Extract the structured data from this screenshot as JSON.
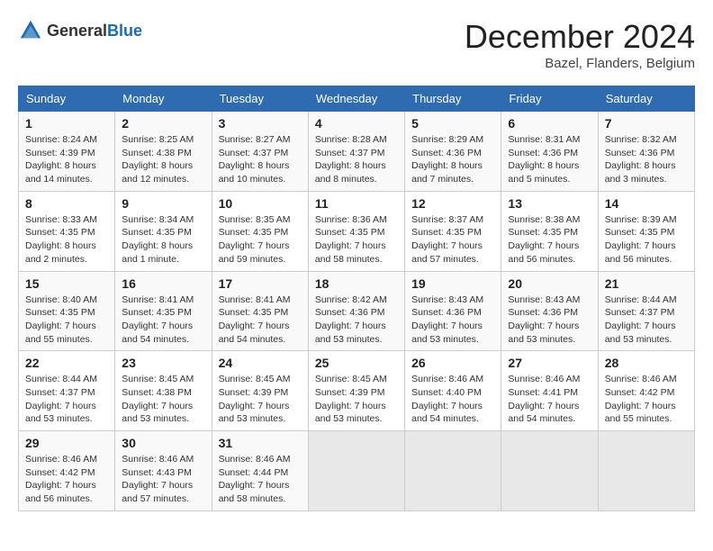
{
  "header": {
    "logo_general": "General",
    "logo_blue": "Blue",
    "month_title": "December 2024",
    "location": "Bazel, Flanders, Belgium"
  },
  "days_of_week": [
    "Sunday",
    "Monday",
    "Tuesday",
    "Wednesday",
    "Thursday",
    "Friday",
    "Saturday"
  ],
  "weeks": [
    [
      {
        "day": "1",
        "sunrise": "8:24 AM",
        "sunset": "4:39 PM",
        "daylight": "8 hours and 14 minutes."
      },
      {
        "day": "2",
        "sunrise": "8:25 AM",
        "sunset": "4:38 PM",
        "daylight": "8 hours and 12 minutes."
      },
      {
        "day": "3",
        "sunrise": "8:27 AM",
        "sunset": "4:37 PM",
        "daylight": "8 hours and 10 minutes."
      },
      {
        "day": "4",
        "sunrise": "8:28 AM",
        "sunset": "4:37 PM",
        "daylight": "8 hours and 8 minutes."
      },
      {
        "day": "5",
        "sunrise": "8:29 AM",
        "sunset": "4:36 PM",
        "daylight": "8 hours and 7 minutes."
      },
      {
        "day": "6",
        "sunrise": "8:31 AM",
        "sunset": "4:36 PM",
        "daylight": "8 hours and 5 minutes."
      },
      {
        "day": "7",
        "sunrise": "8:32 AM",
        "sunset": "4:36 PM",
        "daylight": "8 hours and 3 minutes."
      }
    ],
    [
      {
        "day": "8",
        "sunrise": "8:33 AM",
        "sunset": "4:35 PM",
        "daylight": "8 hours and 2 minutes."
      },
      {
        "day": "9",
        "sunrise": "8:34 AM",
        "sunset": "4:35 PM",
        "daylight": "8 hours and 1 minute."
      },
      {
        "day": "10",
        "sunrise": "8:35 AM",
        "sunset": "4:35 PM",
        "daylight": "7 hours and 59 minutes."
      },
      {
        "day": "11",
        "sunrise": "8:36 AM",
        "sunset": "4:35 PM",
        "daylight": "7 hours and 58 minutes."
      },
      {
        "day": "12",
        "sunrise": "8:37 AM",
        "sunset": "4:35 PM",
        "daylight": "7 hours and 57 minutes."
      },
      {
        "day": "13",
        "sunrise": "8:38 AM",
        "sunset": "4:35 PM",
        "daylight": "7 hours and 56 minutes."
      },
      {
        "day": "14",
        "sunrise": "8:39 AM",
        "sunset": "4:35 PM",
        "daylight": "7 hours and 56 minutes."
      }
    ],
    [
      {
        "day": "15",
        "sunrise": "8:40 AM",
        "sunset": "4:35 PM",
        "daylight": "7 hours and 55 minutes."
      },
      {
        "day": "16",
        "sunrise": "8:41 AM",
        "sunset": "4:35 PM",
        "daylight": "7 hours and 54 minutes."
      },
      {
        "day": "17",
        "sunrise": "8:41 AM",
        "sunset": "4:35 PM",
        "daylight": "7 hours and 54 minutes."
      },
      {
        "day": "18",
        "sunrise": "8:42 AM",
        "sunset": "4:36 PM",
        "daylight": "7 hours and 53 minutes."
      },
      {
        "day": "19",
        "sunrise": "8:43 AM",
        "sunset": "4:36 PM",
        "daylight": "7 hours and 53 minutes."
      },
      {
        "day": "20",
        "sunrise": "8:43 AM",
        "sunset": "4:36 PM",
        "daylight": "7 hours and 53 minutes."
      },
      {
        "day": "21",
        "sunrise": "8:44 AM",
        "sunset": "4:37 PM",
        "daylight": "7 hours and 53 minutes."
      }
    ],
    [
      {
        "day": "22",
        "sunrise": "8:44 AM",
        "sunset": "4:37 PM",
        "daylight": "7 hours and 53 minutes."
      },
      {
        "day": "23",
        "sunrise": "8:45 AM",
        "sunset": "4:38 PM",
        "daylight": "7 hours and 53 minutes."
      },
      {
        "day": "24",
        "sunrise": "8:45 AM",
        "sunset": "4:39 PM",
        "daylight": "7 hours and 53 minutes."
      },
      {
        "day": "25",
        "sunrise": "8:45 AM",
        "sunset": "4:39 PM",
        "daylight": "7 hours and 53 minutes."
      },
      {
        "day": "26",
        "sunrise": "8:46 AM",
        "sunset": "4:40 PM",
        "daylight": "7 hours and 54 minutes."
      },
      {
        "day": "27",
        "sunrise": "8:46 AM",
        "sunset": "4:41 PM",
        "daylight": "7 hours and 54 minutes."
      },
      {
        "day": "28",
        "sunrise": "8:46 AM",
        "sunset": "4:42 PM",
        "daylight": "7 hours and 55 minutes."
      }
    ],
    [
      {
        "day": "29",
        "sunrise": "8:46 AM",
        "sunset": "4:42 PM",
        "daylight": "7 hours and 56 minutes."
      },
      {
        "day": "30",
        "sunrise": "8:46 AM",
        "sunset": "4:43 PM",
        "daylight": "7 hours and 57 minutes."
      },
      {
        "day": "31",
        "sunrise": "8:46 AM",
        "sunset": "4:44 PM",
        "daylight": "7 hours and 58 minutes."
      },
      null,
      null,
      null,
      null
    ]
  ]
}
